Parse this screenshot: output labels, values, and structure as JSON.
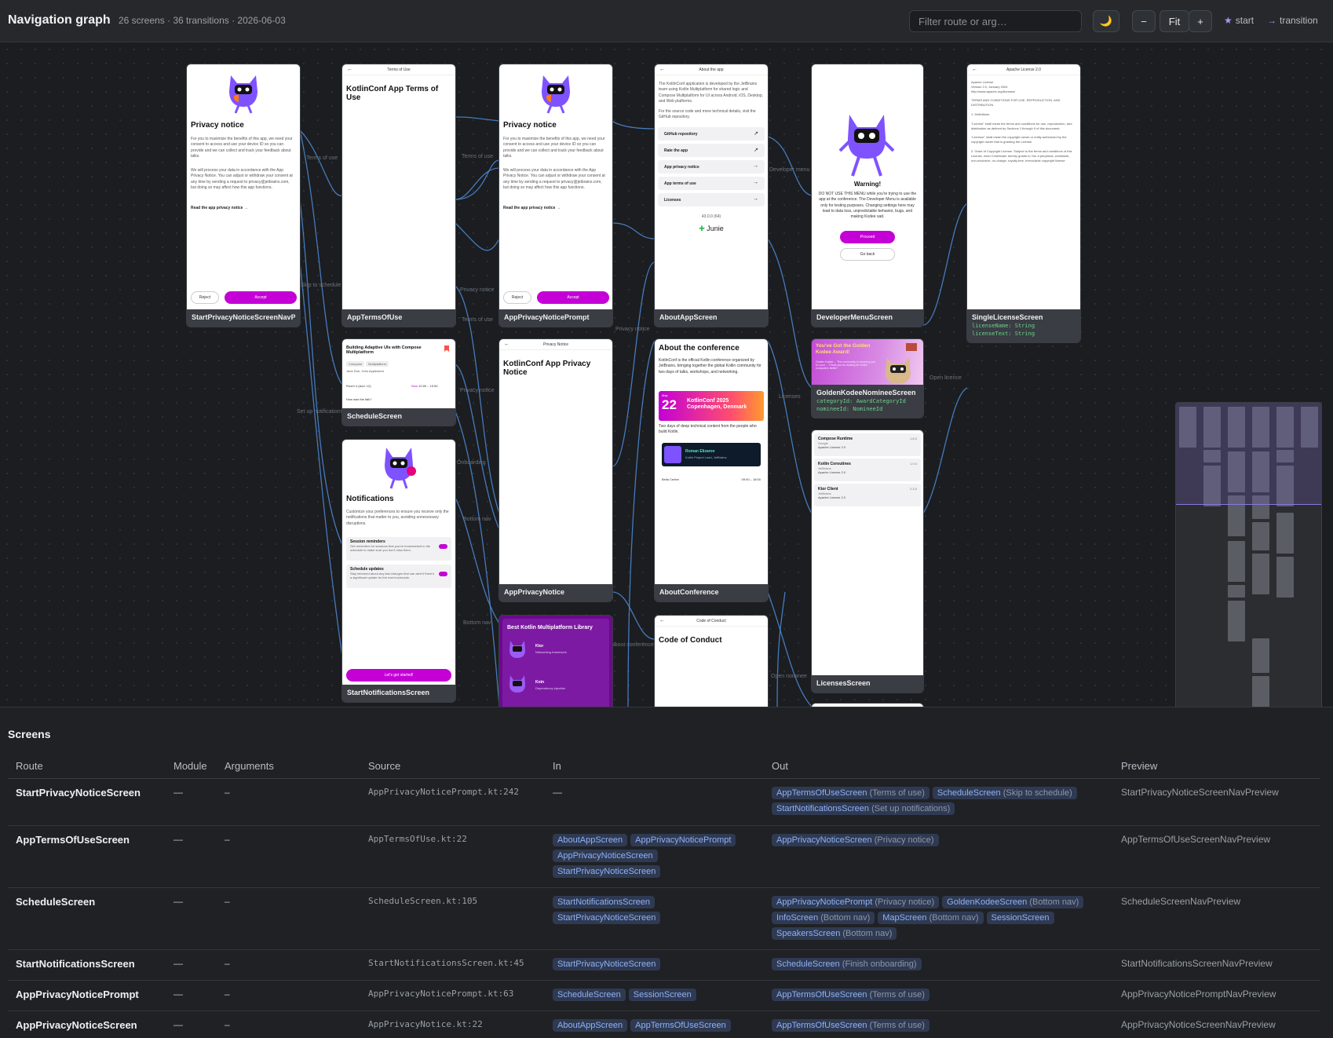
{
  "header": {
    "title": "Navigation graph",
    "meta": "26 screens · 36 transitions · 2026-06-03",
    "filter_placeholder": "Filter route or arg…",
    "theme_icon": "🌙",
    "zoom_out": "−",
    "fit": "Fit",
    "zoom_in": "+",
    "legend_start": "start",
    "legend_transition": "transition"
  },
  "nodes": [
    {
      "id": "start-privacy",
      "caption": "StartPrivacyNoticeScreenNavPrevie",
      "heading": "Privacy notice",
      "body": "For you to maximize the benefits of this app, we need your consent to access and use your device ID so you can provide and we can collect and track your feedback about talks.",
      "body2": "We will process your data in accordance with the App Privacy Notice. You can adjust or withdraw your consent at any time by sending a request to privacy@jetbrains.com, but doing so may affect how this app functions.",
      "link": "Read the app privacy notice  →",
      "reject": "Reject",
      "accept": "Accept"
    },
    {
      "id": "terms",
      "caption": "AppTermsOfUse",
      "bar": "Terms of Use",
      "heading": "KotlinConf App Terms of Use"
    },
    {
      "id": "prompt",
      "caption": "AppPrivacyNoticePrompt",
      "heading": "Privacy notice",
      "body": "For you to maximize the benefits of this app, we need your consent to access and use your device ID so you can provide and we can collect and track your feedback about talks.",
      "body2": "We will process your data in accordance with the App Privacy Notice. You can adjust or withdraw your consent at any time by sending a request to privacy@jetbrains.com, but doing so may affect how this app functions.",
      "link": "Read the app privacy notice  →",
      "reject": "Reject",
      "accept": "Accept"
    },
    {
      "id": "about-app",
      "caption": "AboutAppScreen",
      "bar": "About the app",
      "body": "The KotlinConf application is developed by the JetBrains team using Kotlin Multiplatform for shared logic and Compose Multiplatform for UI across Android, iOS, Desktop, and Web platforms.",
      "body2": "For the source code and more technical details, visit the GitHub repository.",
      "rows": [
        "GitHub repository",
        "Rate the app",
        "App privacy notice",
        "App terms of use",
        "Licenses"
      ],
      "version": "43.0.0 (64)",
      "brand": "Junie"
    },
    {
      "id": "developer",
      "caption": "DeveloperMenuScreen",
      "heading": "Warning!",
      "body": "DO NOT USE THIS MENU while you're trying to use the app at the conference. The Developer Menu is available only for testing purposes. Changing settings here may lead to data loss, unpredictable behavior, bugs, and making Kodee sad.",
      "proceed": "Proceed",
      "goback": "Go back"
    },
    {
      "id": "single-license",
      "caption": "SingleLicenseScreen",
      "bar": "Apache License 2.0",
      "args": [
        "licenseName: String",
        "licenseText: String"
      ],
      "lines": [
        "Apache License",
        "Version 2.0, January 2004",
        "http://www.apache.org/licenses/",
        "TERMS AND CONDITIONS FOR USE, REPRODUCTION, AND DISTRIBUTION",
        "1. Definitions.",
        "\"License\" shall mean the terms and conditions for use, reproduction, and distribution as defined by Sections 1 through 9 of this document.",
        "\"Licensor\" shall mean the copyright owner or entity authorized by the copyright owner that is granting the License.",
        "2. Grant of Copyright License. Subject to the terms and conditions of this License, each Contributor hereby grants to You a perpetual, worldwide, non-exclusive, no-charge, royalty-free, irrevocable copyright license"
      ]
    },
    {
      "id": "schedule",
      "caption": "ScheduleScreen",
      "title": "Building Adaptive UIs with Compose Multiplatform",
      "tags": [
        "Compose",
        "Multiplatform"
      ],
      "speakers": "Jane Doe, John Appleseed",
      "room": "Room 4 (Aud. 12)",
      "now": "Now",
      "time": "10:00 – 10:50",
      "ask": "How was the talk?"
    },
    {
      "id": "notifications",
      "caption": "StartNotificationsScreen",
      "heading": "Notifications",
      "body": "Customize your preferences to ensure you receive only the notifications that matter to you, avoiding unnecessary disruptions.",
      "items": [
        {
          "t": "Session reminders",
          "d": "Get reminders for sessions that you've bookmarked in the schedule to make sure you don't miss them."
        },
        {
          "t": "Schedule updates",
          "d": "Stay informed about any last changes that can alert if there's a significant update for the event schedule."
        }
      ],
      "cta": "Let's get started!"
    },
    {
      "id": "privacy-notice",
      "caption": "AppPrivacyNotice",
      "bar": "Privacy Notice",
      "heading": "KotlinConf App Privacy Notice"
    },
    {
      "id": "about-conf",
      "caption": "AboutConference",
      "heading": "About the conference",
      "body": "KotlinConf is the official Kotlin conference organized by JetBrains, bringing together the global Kotlin community for two days of talks, workshops, and networking.",
      "banner_day": "22",
      "banner_month": "May",
      "banner_title": "KotlinConf 2025 Copenhagen, Denmark",
      "tagline": "Two days of deep technical content from the people who build Kotlin.",
      "speaker": "Roman Elizarov",
      "speaker_role": "Kotlin Project Lead, JetBrains",
      "venue": "Bella Center",
      "venue_time": "09:00 – 18:00"
    },
    {
      "id": "golden",
      "caption": "GoldenKodeeNomineeScreen",
      "heading": "You've Got the Golden Kodee Award!",
      "sub": "Golden Kodee ... The community is honoring you for your ... Thank you for making the Kotlin ecosystem better!",
      "args": [
        "categoryId: AwardCategoryId",
        "nomineeId: NomineeId"
      ]
    },
    {
      "id": "licenses",
      "caption": "LicensesScreen",
      "rows": [
        {
          "n": "Compose Runtime",
          "a": "Google",
          "l": "Apache License 2.0",
          "v": "1.8.0"
        },
        {
          "n": "Kotlin Coroutines",
          "a": "JetBrains",
          "l": "Apache License 2.0",
          "v": "1.9.0"
        },
        {
          "n": "Ktor Client",
          "a": "JetBrains",
          "l": "Apache License 2.0",
          "v": "2.3.0"
        }
      ]
    },
    {
      "id": "best-kmp",
      "caption": "",
      "heading": "Best Kotlin Multiplatform Library",
      "items": [
        {
          "t": "Ktor",
          "d": "Networking framework"
        },
        {
          "t": "Koin",
          "d": "Dependency injection"
        }
      ]
    },
    {
      "id": "coc",
      "caption": "",
      "bar": "Code of Conduct",
      "heading": "Code of Conduct"
    }
  ],
  "edge_labels": [
    "Terms of use",
    "Skip to schedule",
    "Set up notifications",
    "Terms of use",
    "Privacy notice",
    "Terms of use",
    "Privacy notice",
    "Onboarding",
    "Bottom nav",
    "Bottom nav",
    "Privacy notice",
    "About conference",
    "Developer menu",
    "Licenses",
    "Open licence",
    "Open nominee"
  ],
  "panel": {
    "title": "Screens",
    "columns": [
      "Route",
      "Module",
      "Arguments",
      "Source",
      "In",
      "Out",
      "Preview"
    ],
    "rows": [
      {
        "route": "StartPrivacyNoticeScreen",
        "module": "—",
        "args": "–",
        "source": "AppPrivacyNoticePrompt.kt:242",
        "in_text": "—",
        "in": [],
        "out": [
          {
            "to": "AppTermsOfUseScreen",
            "via": "(Terms of use)"
          },
          {
            "to": "ScheduleScreen",
            "via": "(Skip to schedule)"
          },
          {
            "to": "StartNotificationsScreen",
            "via": "(Set up notifications)"
          }
        ],
        "preview": "StartPrivacyNoticeScreenNavPreview"
      },
      {
        "route": "AppTermsOfUseScreen",
        "module": "—",
        "args": "–",
        "source": "AppTermsOfUse.kt:22",
        "in_text": "",
        "in": [
          "AboutAppScreen",
          "AppPrivacyNoticePrompt",
          "AppPrivacyNoticeScreen",
          "StartPrivacyNoticeScreen"
        ],
        "out": [
          {
            "to": "AppPrivacyNoticeScreen",
            "via": "(Privacy notice)"
          }
        ],
        "preview": "AppTermsOfUseScreenNavPreview"
      },
      {
        "route": "ScheduleScreen",
        "module": "—",
        "args": "–",
        "source": "ScheduleScreen.kt:105",
        "in_text": "",
        "in": [
          "StartNotificationsScreen",
          "StartPrivacyNoticeScreen"
        ],
        "out": [
          {
            "to": "AppPrivacyNoticePrompt",
            "via": "(Privacy notice)"
          },
          {
            "to": "GoldenKodeeScreen",
            "via": "(Bottom nav)"
          },
          {
            "to": "InfoScreen",
            "via": "(Bottom nav)"
          },
          {
            "to": "MapScreen",
            "via": "(Bottom nav)"
          },
          {
            "to": "SessionScreen",
            "via": ""
          },
          {
            "to": "SpeakersScreen",
            "via": "(Bottom nav)"
          }
        ],
        "preview": "ScheduleScreenNavPreview"
      },
      {
        "route": "StartNotificationsScreen",
        "module": "—",
        "args": "–",
        "source": "StartNotificationsScreen.kt:45",
        "in_text": "",
        "in": [
          "StartPrivacyNoticeScreen"
        ],
        "out": [
          {
            "to": "ScheduleScreen",
            "via": "(Finish onboarding)"
          }
        ],
        "preview": "StartNotificationsScreenNavPreview"
      },
      {
        "route": "AppPrivacyNoticePrompt",
        "module": "—",
        "args": "–",
        "source": "AppPrivacyNoticePrompt.kt:63",
        "in_text": "",
        "in": [
          "ScheduleScreen",
          "SessionScreen"
        ],
        "out": [
          {
            "to": "AppTermsOfUseScreen",
            "via": "(Terms of use)"
          }
        ],
        "preview": "AppPrivacyNoticePromptNavPreview"
      },
      {
        "route": "AppPrivacyNoticeScreen",
        "module": "—",
        "args": "–",
        "source": "AppPrivacyNotice.kt:22",
        "in_text": "",
        "in": [
          "AboutAppScreen",
          "AppTermsOfUseScreen"
        ],
        "out": [
          {
            "to": "AppTermsOfUseScreen",
            "via": "(Terms of use)"
          }
        ],
        "preview": "AppPrivacyNoticeScreenNavPreview"
      }
    ]
  },
  "colors": {
    "accent": "#c400d6",
    "edge": "#4d8bd8",
    "chip_bg": "#2f3a52",
    "chip_text": "#8fb1f5",
    "arg_text": "#6fd08c"
  }
}
